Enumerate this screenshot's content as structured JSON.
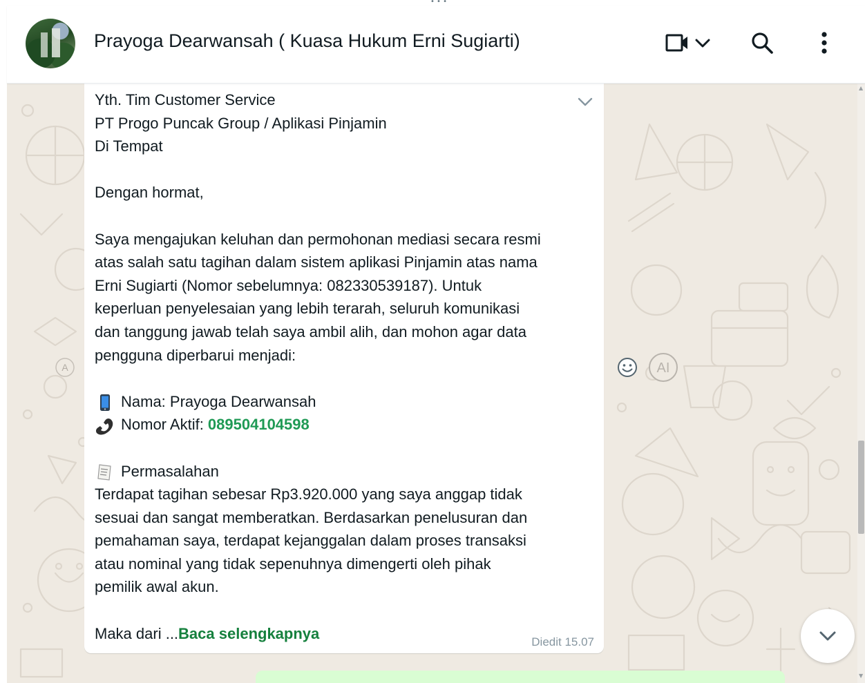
{
  "header": {
    "contact_name": "Prayoga Dearwansah ( Kuasa Hukum Erni Sugiarti)",
    "icons": [
      "avatar",
      "video-call-icon",
      "chevron-down-icon",
      "search-icon",
      "more-vert-icon"
    ]
  },
  "message": {
    "lines": {
      "l1": "Yth. Tim Customer Service",
      "l2": "PT Progo Puncak Group / Aplikasi Pinjamin",
      "l3": "Di Tempat",
      "l4": "Dengan hormat,",
      "l5": "Saya mengajukan keluhan dan permohonan mediasi secara resmi",
      "l6": "atas salah satu tagihan dalam sistem aplikasi Pinjamin atas nama",
      "l7": "Erni Sugiarti (Nomor sebelumnya: 082330539187). Untuk",
      "l8": "keperluan penyelesaian yang lebih terarah, seluruh komunikasi",
      "l9": "dan tanggung jawab telah saya ambil alih, dan mohon agar data",
      "l10": "pengguna diperbarui menjadi:",
      "name_line": "Nama: Prayoga Dearwansah",
      "phone_label": "Nomor Aktif: ",
      "phone_number": "089504104598",
      "issue_heading": "Permasalahan",
      "l11": "Terdapat tagihan sebesar Rp3.920.000 yang saya anggap tidak",
      "l12": "sesuai dan sangat memberatkan. Berdasarkan penelusuran dan",
      "l13": "pemahaman saya, terdapat kejanggalan dalam proses transaksi",
      "l14": "atau nominal yang tidak sepenuhnya dimengerti oleh pihak",
      "l15": "pemilik awal akun.",
      "tail": "Maka dari ...",
      "read_more": "Baca selengkapnya"
    },
    "timestamp": "Diedit 15.07",
    "emoji_icons": [
      "mobile-phone-icon",
      "telephone-receiver-icon",
      "receipt-icon"
    ]
  },
  "side": {
    "sender_initial": "A",
    "ai_label": "AI"
  },
  "colors": {
    "chat_bg": "#efeae2",
    "link_green": "#1f9a55",
    "outgoing_bubble": "#d9fdd3",
    "timestamp": "#8696a0"
  }
}
